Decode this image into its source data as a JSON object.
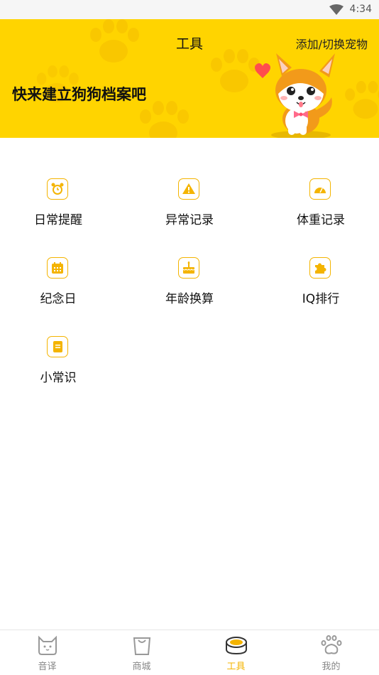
{
  "status_bar": {
    "time": "4:34",
    "wifi_icon": "wifi-icon"
  },
  "header": {
    "title": "工具",
    "switch_pet": "添加/切换宠物",
    "slogan": "快来建立狗狗档案吧",
    "background_color": "#ffd400"
  },
  "tools": [
    {
      "label": "日常提醒",
      "icon": "alarm-clock-icon"
    },
    {
      "label": "异常记录",
      "icon": "warning-icon"
    },
    {
      "label": "体重记录",
      "icon": "scale-icon"
    },
    {
      "label": "纪念日",
      "icon": "calendar-icon"
    },
    {
      "label": "年龄换算",
      "icon": "cake-icon"
    },
    {
      "label": "IQ排行",
      "icon": "puzzle-icon"
    },
    {
      "label": "小常识",
      "icon": "notebook-icon"
    }
  ],
  "bottom_nav": [
    {
      "label": "音译",
      "icon": "cat-face-icon",
      "active": false
    },
    {
      "label": "商城",
      "icon": "shopping-bag-icon",
      "active": false
    },
    {
      "label": "工具",
      "icon": "pet-bowl-icon",
      "active": true
    },
    {
      "label": "我的",
      "icon": "paw-icon",
      "active": false
    }
  ],
  "colors": {
    "accent": "#f4b400",
    "inactive": "#888888"
  }
}
